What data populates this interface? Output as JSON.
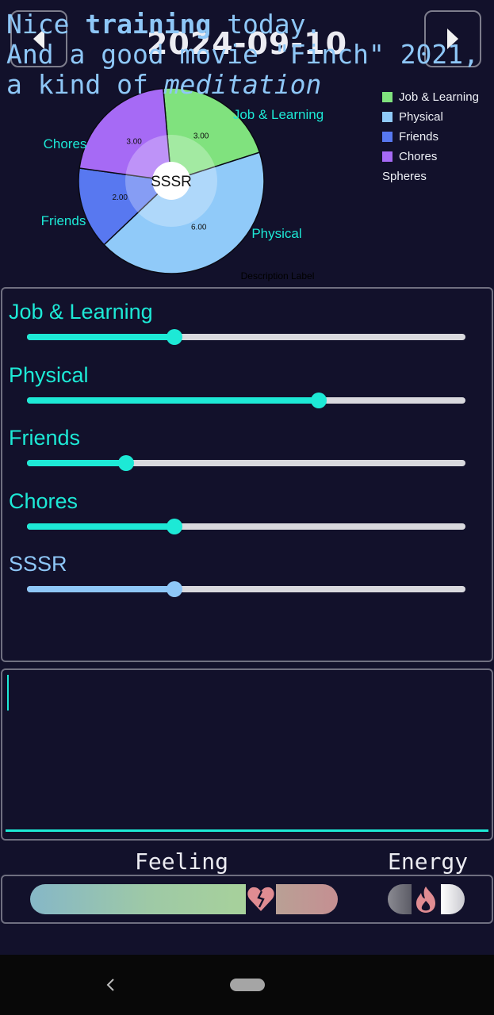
{
  "header": {
    "date": "2024-09-10",
    "prev_icon": "left-triangle-icon",
    "next_icon": "right-triangle-icon"
  },
  "chart_data": {
    "type": "pie",
    "center_label": "SSSR",
    "description": "Description Label",
    "legend_title": "Spheres",
    "legend_position": "top-right",
    "slices": [
      {
        "label": "Job & Learning",
        "value": 3.0,
        "value_label": "3.00",
        "color": "#80e27e"
      },
      {
        "label": "Physical",
        "value": 6.0,
        "value_label": "6.00",
        "color": "#90caf9"
      },
      {
        "label": "Friends",
        "value": 2.0,
        "value_label": "2.00",
        "color": "#5878f0"
      },
      {
        "label": "Chores",
        "value": 3.0,
        "value_label": "3.00",
        "color": "#a66af5"
      }
    ]
  },
  "sliders": [
    {
      "label": "Job & Learning",
      "fraction": 0.336,
      "color": "#1de9d6"
    },
    {
      "label": "Physical",
      "fraction": 0.665,
      "color": "#1de9d6"
    },
    {
      "label": "Friends",
      "fraction": 0.226,
      "color": "#1de9d6"
    },
    {
      "label": "Chores",
      "fraction": 0.336,
      "color": "#1de9d6"
    },
    {
      "label": "SSSR",
      "fraction": 0.336,
      "color": "#8ec7f7"
    }
  ],
  "note": {
    "line1_a": "Nice ",
    "line1_b": "training",
    "line1_c": " today.",
    "line2": "And a good movie \"Finch\" 2021,",
    "line3_a": "a kind of ",
    "line3_b": "meditation"
  },
  "mood": {
    "feeling_label": "Feeling",
    "energy_label": "Energy",
    "feeling_icon": "broken-heart-icon",
    "energy_icon": "flame-icon"
  },
  "colors": {
    "accent": "#1de9d6",
    "background": "#12112b",
    "secondary": "#8ec7f7"
  }
}
